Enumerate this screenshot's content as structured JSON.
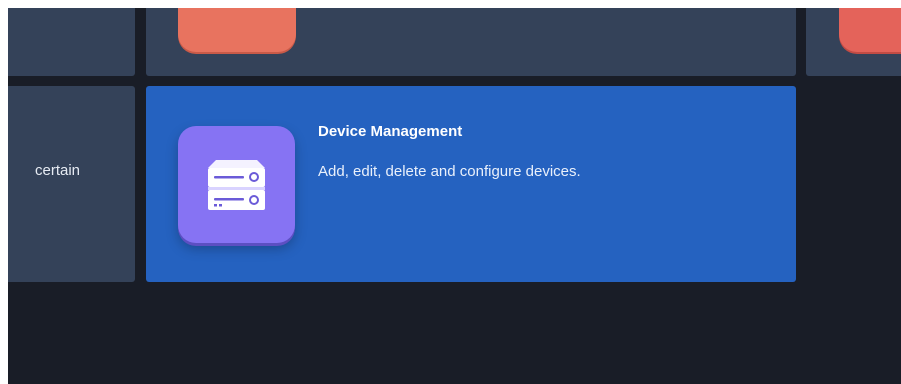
{
  "tiles": {
    "row2_left": {
      "label_partial": "certain"
    },
    "device_management": {
      "title": "Device Management",
      "description": "Add, edit, delete and configure devices.",
      "icon": "server-device-icon",
      "state": "selected"
    }
  },
  "colors": {
    "background": "#191d27",
    "tile": "#344259",
    "tile_active": "#2562c0",
    "device_icon": "#8673f3",
    "top_icon_coral": "#e8735f",
    "top_icon_red": "#e4635a"
  }
}
